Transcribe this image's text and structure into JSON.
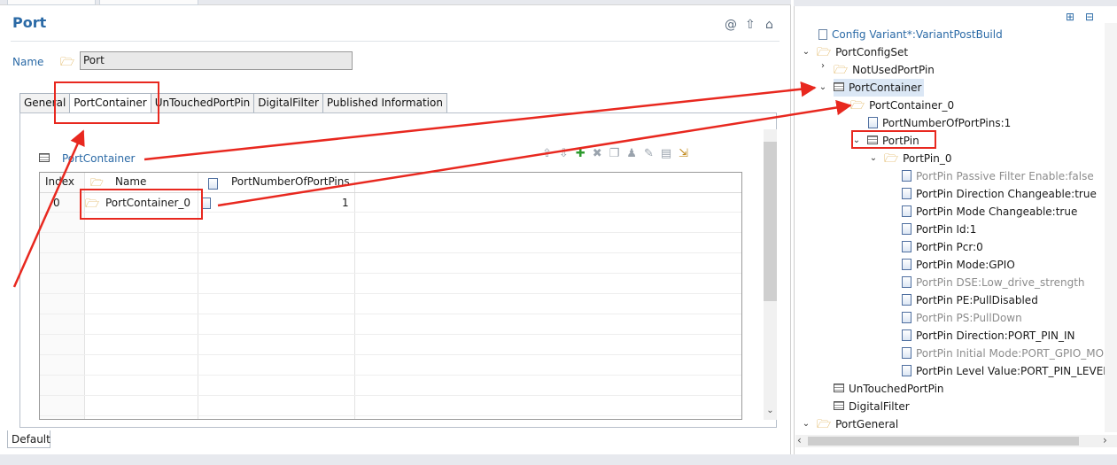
{
  "editor": {
    "title": "Port",
    "name_label": "Name",
    "name_value": "Port",
    "header_icons": [
      "@",
      "⇧",
      "⌂"
    ],
    "tabs": [
      "General",
      "PortContainer",
      "UnTouchedPortPin",
      "DigitalFilter",
      "Published Information"
    ],
    "active_tab": "PortContainer",
    "section_label": "PortContainer",
    "table": {
      "headers": [
        "Index",
        "Name",
        "PortNumberOfPortPins"
      ],
      "rows": [
        {
          "index": "0",
          "name": "PortContainer_0",
          "pins": "1"
        }
      ]
    },
    "footer_tab": "Default"
  },
  "tree": {
    "root_doc": "Config Variant*:VariantPostBuild",
    "portconfigset": "PortConfigSet",
    "notused": "NotUsedPortPin",
    "portcontainer": "PortContainer",
    "portcontainer0": "PortContainer_0",
    "numpins": "PortNumberOfPortPins:1",
    "portpin": "PortPin",
    "portpin0": "PortPin_0",
    "params": [
      "PortPin Passive Filter Enable:false",
      "PortPin Direction Changeable:true",
      "PortPin Mode Changeable:true",
      "PortPin Id:1",
      "PortPin Pcr:0",
      "PortPin Mode:GPIO",
      "PortPin DSE:Low_drive_strength",
      "PortPin PE:PullDisabled",
      "PortPin PS:PullDown",
      "PortPin Direction:PORT_PIN_IN",
      "PortPin Initial Mode:PORT_GPIO_MOD",
      "PortPin Level Value:PORT_PIN_LEVEL_L"
    ],
    "untouched": "UnTouchedPortPin",
    "digital": "DigitalFilter",
    "general": "PortGeneral"
  },
  "colors": {
    "accent": "#2b6aa6",
    "annotation": "#e8281f",
    "folder": "#d59b27"
  }
}
